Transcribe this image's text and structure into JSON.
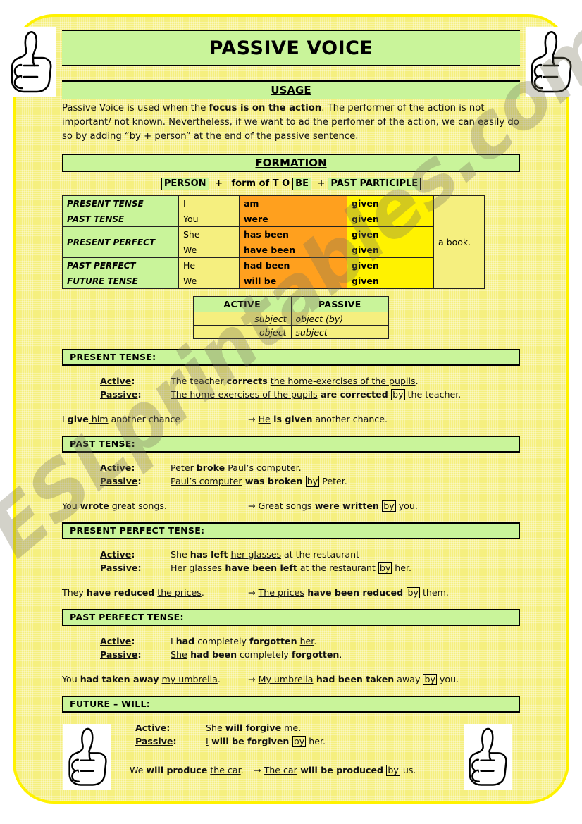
{
  "watermark": {
    "text": "ESLprintables.com"
  },
  "header": {
    "title": "PASSIVE VOICE",
    "usage_heading": "USAGE",
    "thumb_icon": "thumbs-up-icon"
  },
  "usage": {
    "p1a": "Passive Voice is used when the ",
    "p1b": "focus is on the action",
    "p1c": ". The performer of the action is not important/ not known. Nevertheless, if we want to ad the perfomer of the action, we can easily do so by adding “by + person” at the end of the passive sentence."
  },
  "formation": {
    "heading": "FORMATION",
    "formula": {
      "person": "PERSON",
      "plus1": "+",
      "form_of": "form of T O",
      "be": "BE",
      "plus2": "+",
      "past_participle": "PAST PARTICIPLE"
    },
    "table": {
      "rows": [
        {
          "tense": "PRESENT TENSE",
          "person": "I",
          "be": "am",
          "pp": "given"
        },
        {
          "tense": "PAST TENSE",
          "person": "You",
          "be": "were",
          "pp": "given"
        },
        {
          "tense": "PRESENT PERFECT",
          "person": "She",
          "be": "has been",
          "pp": "given"
        },
        {
          "tense": "",
          "person": "We",
          "be": "have been",
          "pp": "given"
        },
        {
          "tense": "PAST PERFECT",
          "person": "He",
          "be": "had been",
          "pp": "given"
        },
        {
          "tense": "FUTURE TENSE",
          "person": "We",
          "be": "will be",
          "pp": "given"
        }
      ],
      "object": "a book."
    }
  },
  "ap_table": {
    "head_active": "ACTIVE",
    "head_passive": "PASSIVE",
    "row1_active": "subject",
    "row1_passive": "object (by)",
    "row2_active": "object",
    "row2_passive": "subject"
  },
  "labels": {
    "active": "Active",
    "passive": "Passive",
    "colon": ":",
    "by": "by",
    "arrow": "→"
  },
  "sections": {
    "present": {
      "bar": "PRESENT TENSE:",
      "active": {
        "a": "The teacher ",
        "b": "corrects",
        "c": " ",
        "u": "the home-exercises of the pupils",
        "d": "."
      },
      "passive": {
        "u1": "The home-exercises of the pupils",
        "b": " are corrected ",
        "by": "by",
        "d": " the teacher."
      },
      "ex_left": {
        "a": "I ",
        "b": "give",
        "u": " him",
        "c": " another chance"
      },
      "ex_right": {
        "u": "He",
        "b": " is given",
        "c": " another chance."
      }
    },
    "past": {
      "bar": "PAST TENSE:",
      "active": {
        "a": "Peter ",
        "b": "broke",
        "c": " ",
        "u": "Paul’s computer",
        "d": "."
      },
      "passive": {
        "u1": "Paul’s computer",
        "b": " was broken ",
        "by": "by",
        "d": " Peter."
      },
      "ex_left": {
        "a": "You ",
        "b": "wrote",
        "c": " ",
        "u": "great songs."
      },
      "ex_right": {
        "u": "Great songs",
        "b": " were written ",
        "by": "by",
        "c": " you."
      }
    },
    "present_perfect": {
      "bar": "PRESENT PERFECT TENSE:",
      "active": {
        "a": "She ",
        "b": "has left",
        "c": " ",
        "u": "her glasses",
        "d": " at the restaurant"
      },
      "passive": {
        "u1": "Her glasses",
        "b": " have been left",
        "c": " at the restaurant ",
        "by": "by",
        "d": " her."
      },
      "ex_left": {
        "a": "They ",
        "b": "have reduced",
        "c": " ",
        "u": "the prices",
        "d": "."
      },
      "ex_right": {
        "u": "The prices",
        "b": " have been reduced ",
        "by": "by",
        "c": " them."
      }
    },
    "past_perfect": {
      "bar": "PAST PERFECT TENSE:",
      "active": {
        "a": "I ",
        "b": "had",
        "c": " completely ",
        "b2": "forgotten",
        "c2": " ",
        "u": "her",
        "d": "."
      },
      "passive": {
        "u1": "She",
        "b": " had been",
        "c": " completely ",
        "b2": "forgotten",
        "d": "."
      },
      "ex_left": {
        "a": "You ",
        "b": "had taken away",
        "c": " ",
        "u": "my umbrella",
        "d": "."
      },
      "ex_right": {
        "u": "My umbrella",
        "b": " had been taken",
        "c": " away ",
        "by": "by",
        "d": " you."
      }
    },
    "future": {
      "bar": "FUTURE – WILL:",
      "active": {
        "a": "She ",
        "b": "will forgive",
        "c": " ",
        "u": "me",
        "d": "."
      },
      "passive": {
        "u1": "I",
        "b": " will be forgiven ",
        "by": "by",
        "d": " her."
      },
      "ex_left": {
        "a": "We ",
        "b": "will produce",
        "c": " ",
        "u": "the car",
        "d": "."
      },
      "ex_right": {
        "u": "The car",
        "b": " will be produced ",
        "by": "by",
        "c": " us."
      }
    }
  },
  "colors": {
    "page_yellow": "#f5ef7f",
    "border_yellow": "#fff200",
    "green": "#c9f49a",
    "orange": "#ffa01e",
    "bright_yellow": "#fff200"
  }
}
